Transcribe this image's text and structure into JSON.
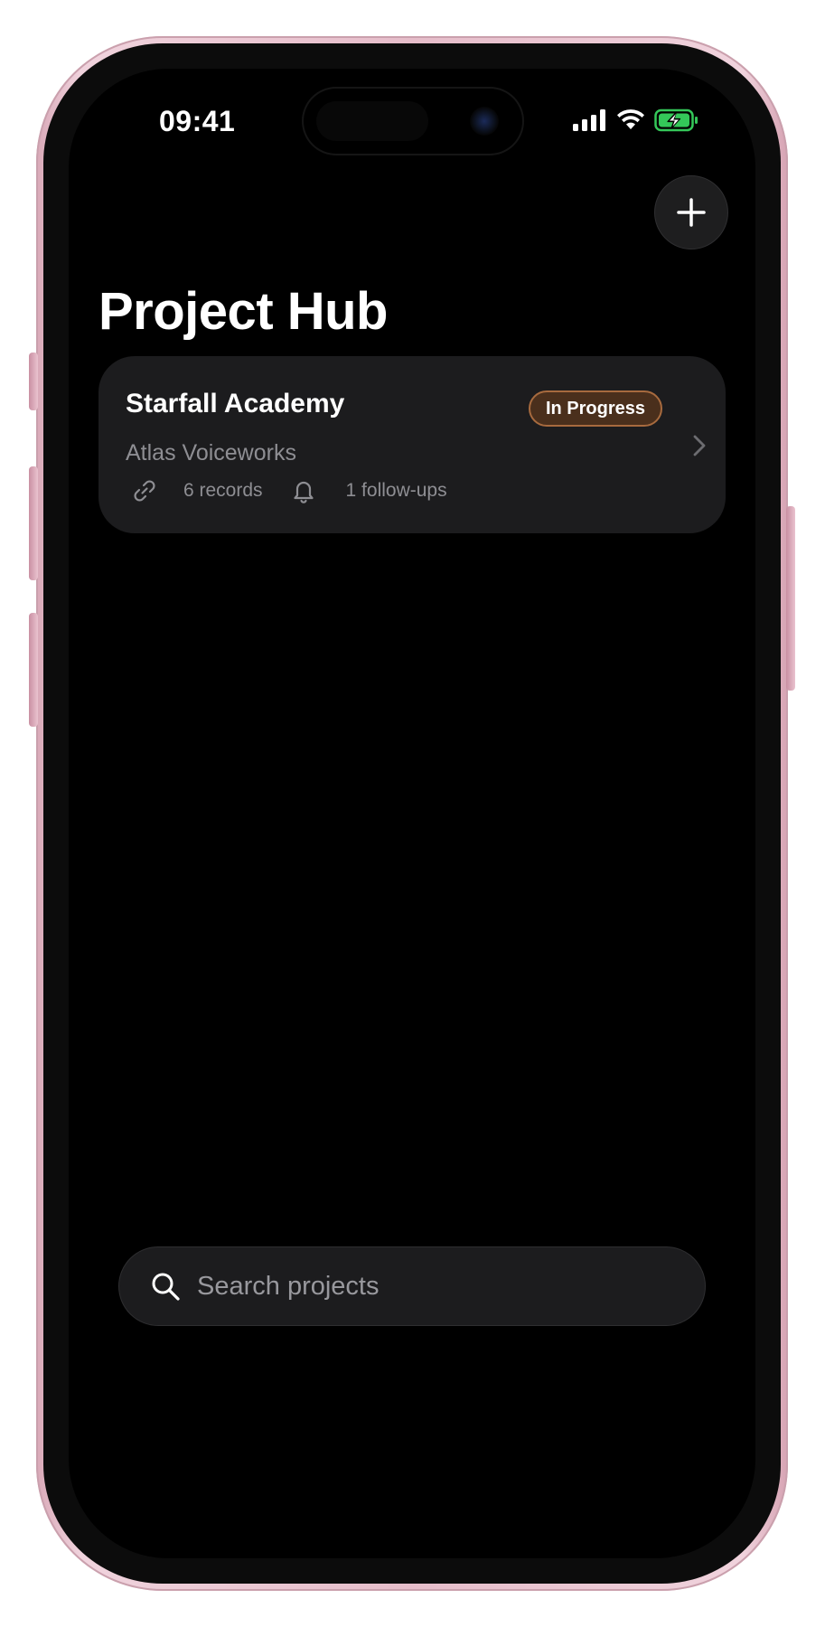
{
  "status_bar": {
    "time": "09:41",
    "signal_icon": "cellular-signal-icon",
    "wifi_icon": "wifi-icon",
    "battery_icon": "battery-charging-icon",
    "battery_color": "#34c759"
  },
  "header": {
    "title": "Project Hub",
    "add_icon": "plus-icon"
  },
  "projects": [
    {
      "name": "Starfall Academy",
      "client": "Atlas Voiceworks",
      "status": "In Progress",
      "status_color": "#a76a3e",
      "records_label": "6 records",
      "followups_label": "1 follow-ups",
      "records_icon": "link-icon",
      "followups_icon": "bell-icon",
      "chevron_icon": "chevron-right-icon"
    }
  ],
  "search": {
    "placeholder": "Search projects",
    "value": ""
  }
}
